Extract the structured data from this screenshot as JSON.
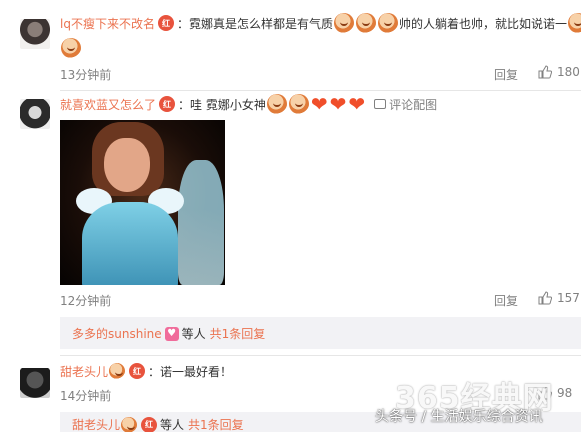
{
  "comments": [
    {
      "username": "lq不瘦下来不改名",
      "text_a": "：霓娜真是怎么样都是有气质",
      "text_b": "帅的人躺着也帅，就比如说诺一",
      "time": "13分钟前",
      "reply_label": "回复",
      "likes": "180"
    },
    {
      "username": "就喜欢蓝又怎么了",
      "text_a": "：哇 霓娜小女神",
      "view_image_label": "评论配图",
      "time": "12分钟前",
      "reply_label": "回复",
      "likes": "157",
      "sub_reply": {
        "username": "多多的sunshine",
        "suffix": "等人",
        "count_label": "共1条回复"
      }
    },
    {
      "username": "甜老头儿",
      "text_a": "：诺一最好看！",
      "time": "14分钟前",
      "likes": "98",
      "sub_reply": {
        "username": "甜老头儿",
        "suffix": "等人",
        "count_label": "共1条回复"
      }
    }
  ],
  "watermark": {
    "line1": "365经典网",
    "line2": "头条号 / 生活娱乐综合资讯"
  },
  "badge_text": "红",
  "colors": {
    "username": "#eb7350",
    "text": "#333333",
    "meta": "#808080"
  }
}
